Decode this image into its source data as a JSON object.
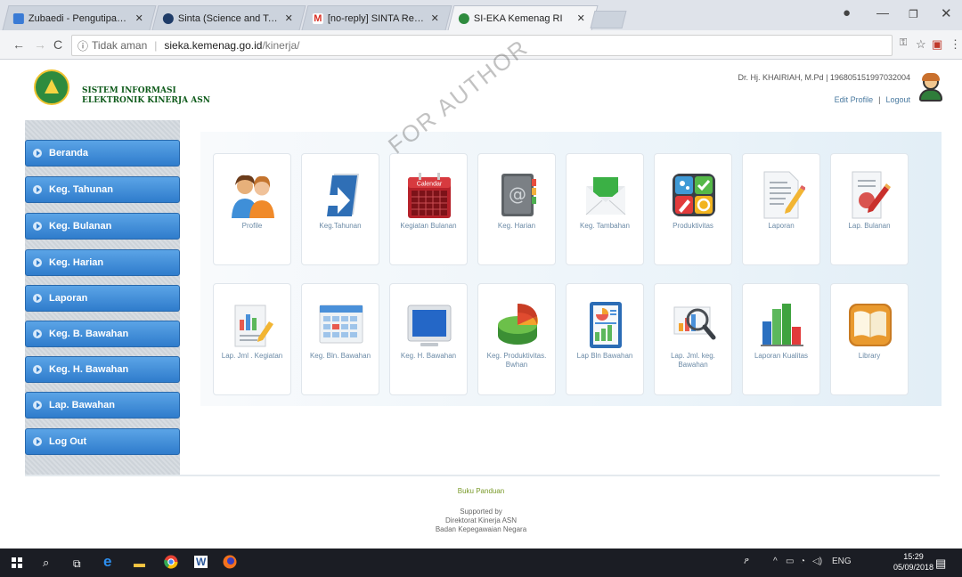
{
  "browser": {
    "tabs": [
      {
        "title": "Zubaedi - Pengutipan Go",
        "favicon_color": "#3a7bd5",
        "active": false
      },
      {
        "title": "Sinta (Science and Techn",
        "favicon_color": "#1f3c68",
        "active": false
      },
      {
        "title": "[no-reply] SINTA Registr",
        "favicon_color": "#d93025",
        "active": false
      },
      {
        "title": "SI-EKA Kemenag RI",
        "favicon_color": "#2e8b3e",
        "active": true
      }
    ],
    "security_label": "Tidak aman",
    "url_host": "sieka.kemenag.go.id",
    "url_path": "/kinerja/"
  },
  "header": {
    "title_line1": "SISTEM INFORMASI",
    "title_line2": "ELEKTRONIK KINERJA ASN",
    "user_name": "Dr. Hj. KHAIRIAH, M.Pd | 196805151997032004",
    "edit_profile": "Edit Profile",
    "logout": "Logout"
  },
  "sidebar": {
    "items": [
      {
        "label": "Beranda"
      },
      {
        "label": "Keg. Tahunan"
      },
      {
        "label": "Keg. Bulanan"
      },
      {
        "label": "Keg. Harian"
      },
      {
        "label": "Laporan"
      },
      {
        "label": "Keg. B. Bawahan"
      },
      {
        "label": "Keg. H. Bawahan"
      },
      {
        "label": "Lap. Bawahan"
      },
      {
        "label": "Log Out"
      }
    ]
  },
  "menu": {
    "row1": [
      {
        "label": "Profile",
        "icon": "users-icon"
      },
      {
        "label": "Keg.Tahunan",
        "icon": "arrow-doc-icon"
      },
      {
        "label": "Kegiatan Bulanan",
        "icon": "calendar-icon"
      },
      {
        "label": "Keg. Harian",
        "icon": "address-book-icon"
      },
      {
        "label": "Keg. Tambahan",
        "icon": "envelope-icon"
      },
      {
        "label": "Produktivitas",
        "icon": "apps-icon"
      },
      {
        "label": "Laporan",
        "icon": "doc-pencil-icon"
      },
      {
        "label": "Lap. Bulanan",
        "icon": "doc-pencil-red-icon"
      }
    ],
    "row2": [
      {
        "label": "Lap. Jml . Kegiatan",
        "icon": "chart-pencil-icon"
      },
      {
        "label": "Keg. Bln. Bawahan",
        "icon": "calendar-grid-icon"
      },
      {
        "label": "Keg. H. Bawahan",
        "icon": "monitor-icon"
      },
      {
        "label": "Keg. Produktivitas. Bwhan",
        "icon": "pie-3d-icon"
      },
      {
        "label": "Lap Bln Bawahan",
        "icon": "report-icon"
      },
      {
        "label": "Lap. Jml. keg. Bawahan",
        "icon": "magnifier-chart-icon"
      },
      {
        "label": "Laporan Kualitas",
        "icon": "bar-chart-icon"
      },
      {
        "label": "Library",
        "icon": "book-icon"
      }
    ]
  },
  "footer": {
    "guide": "Buku Panduan",
    "supported_by": "Supported by",
    "line1": "Direktorat Kinerja ASN",
    "line2": "Badan Kepegawaian Negara"
  },
  "taskbar": {
    "language": "ENG",
    "time": "15:29",
    "date": "05/09/2018"
  },
  "watermark": "FOR AUTHOR"
}
